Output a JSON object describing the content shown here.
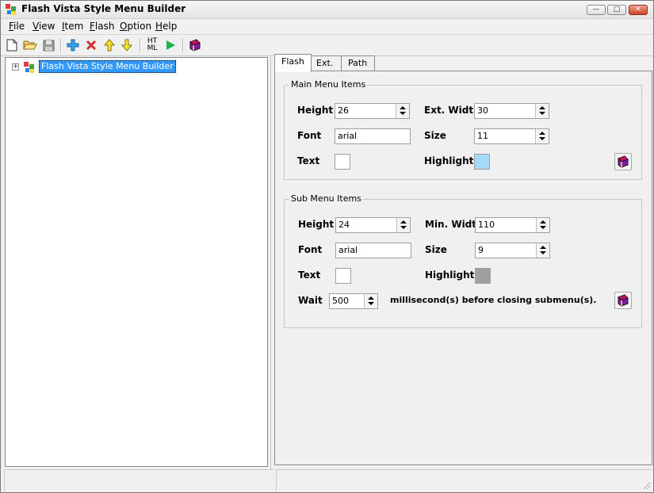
{
  "window": {
    "title": "Flash Vista Style Menu Builder",
    "controls": {
      "minimize": "—",
      "maximize": "□",
      "close": "✕"
    }
  },
  "menu": [
    {
      "underline": "F",
      "rest": "ile"
    },
    {
      "underline": "V",
      "rest": "iew"
    },
    {
      "underline": "I",
      "rest": "tem"
    },
    {
      "underline": "F",
      "rest": "lash"
    },
    {
      "underline": "O",
      "rest": "ption"
    },
    {
      "underline": "H",
      "rest": "elp"
    }
  ],
  "toolbar": {
    "html_label_top": "HT",
    "html_label_bottom": "ML"
  },
  "tree": {
    "expander": "+",
    "root_label": "Flash Vista Style Menu Builder"
  },
  "tabs": [
    "Flash",
    "Ext.",
    "Path"
  ],
  "main_menu": {
    "title": "Main Menu Items",
    "height_label": "Height",
    "height_value": "26",
    "ext_width_label": "Ext. Width",
    "ext_width_value": "30",
    "font_label": "Font",
    "font_value": "arial",
    "size_label": "Size",
    "size_value": "11",
    "text_label": "Text",
    "text_color": "#ffffff",
    "highlight_label": "Highlight",
    "highlight_color": "#a6d8f7"
  },
  "sub_menu": {
    "title": "Sub Menu Items",
    "height_label": "Height",
    "height_value": "24",
    "min_width_label": "Min. Width",
    "min_width_value": "110",
    "font_label": "Font",
    "font_value": "arial",
    "size_label": "Size",
    "size_value": "9",
    "text_label": "Text",
    "text_color": "#ffffff",
    "highlight_label": "Highlight",
    "highlight_color": "#a0a0a0",
    "wait_label": "Wait",
    "wait_value": "500",
    "wait_suffix": "millisecond(s) before closing submenu(s)."
  }
}
